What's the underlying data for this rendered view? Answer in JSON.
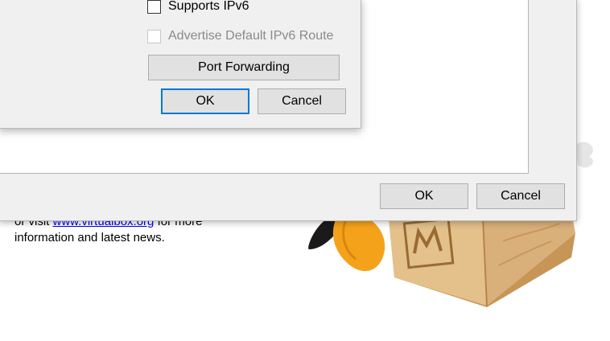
{
  "welcome": {
    "line1_prefix": "or visit ",
    "link": "www.virtualbox.org",
    "line1_suffix": " for more",
    "line2": "information and latest news."
  },
  "outer_dialog": {
    "ok_label": "OK",
    "cancel_label": "Cancel"
  },
  "inner_dialog": {
    "supports_ipv6": {
      "label": "Supports IPv6",
      "checked": false,
      "enabled": true
    },
    "advertise_route": {
      "label": "Advertise Default IPv6 Route",
      "checked": false,
      "enabled": false
    },
    "port_forwarding_label": "Port Forwarding",
    "ok_label": "OK",
    "cancel_label": "Cancel"
  },
  "mascot": {
    "icon": "virtualbox-mascot-art"
  }
}
